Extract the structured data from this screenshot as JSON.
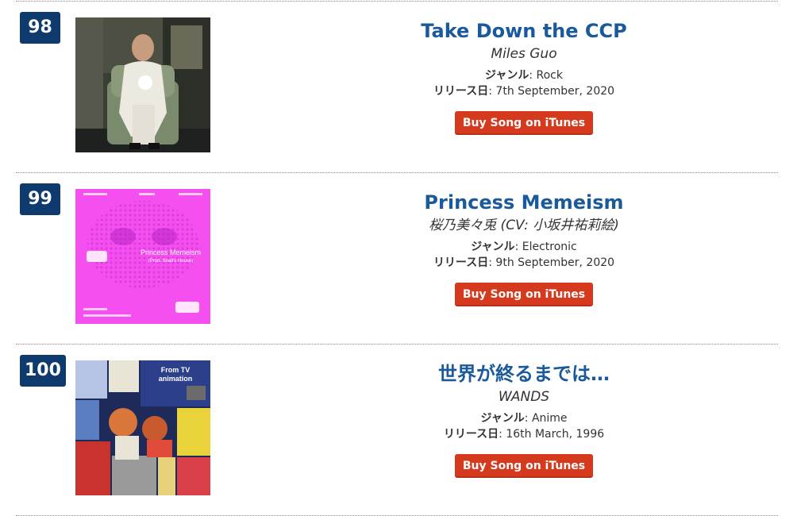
{
  "labels": {
    "genre": "ジャンル",
    "release": "リリース日",
    "buy": "Buy Song on iTunes"
  },
  "entries": [
    {
      "rank": "98",
      "title": "Take Down the CCP",
      "artist": "Miles Guo",
      "genre": "Rock",
      "release_date": "7th September, 2020"
    },
    {
      "rank": "99",
      "title": "Princess Memeism",
      "artist": "桜乃美々兎 (CV: 小坂井祐莉絵)",
      "genre": "Electronic",
      "release_date": "9th September, 2020",
      "cover_text": {
        "main": "Princess Memeism",
        "sub": "(Prod. Snail's House)"
      }
    },
    {
      "rank": "100",
      "title": "世界が終るまでは…",
      "artist": "WANDS",
      "genre": "Anime",
      "release_date": "16th March, 1996",
      "cover_text": {
        "line1": "From TV",
        "line2": "animation"
      }
    }
  ],
  "colors": {
    "badge": "#0e3a6d",
    "title": "#1a5a9c",
    "button": "#d63a1e"
  }
}
